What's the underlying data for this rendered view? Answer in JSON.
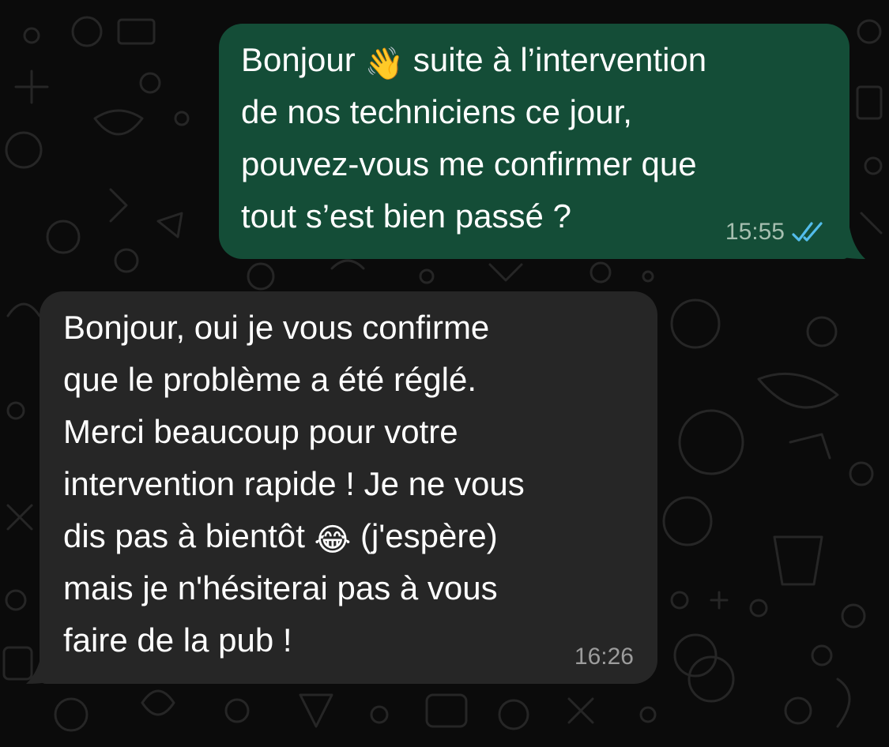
{
  "colors": {
    "background": "#0b0b0b",
    "outgoing_bubble": "#144d37",
    "incoming_bubble": "#262626",
    "read_ticks": "#53bdeb"
  },
  "messages": [
    {
      "direction": "outgoing",
      "text_part1": "Bonjour ",
      "emoji": "👋",
      "text_part2": " suite à l’intervention\nde nos techniciens ce jour,\npouvez-vous me confirmer que\ntout s’est bien passé ?",
      "time": "15:55",
      "status_icon": "double-check-read-icon"
    },
    {
      "direction": "incoming",
      "text_part1": "Bonjour, oui je vous confirme\nque le problème a été réglé.\nMerci beaucoup pour votre\nintervention rapide ! Je ne vous\ndis pas à bientôt ",
      "emoji": "😂",
      "text_part2": " (j'espère)\nmais je n'hésiterai pas à vous\nfaire de la pub !",
      "time": "16:26"
    }
  ]
}
